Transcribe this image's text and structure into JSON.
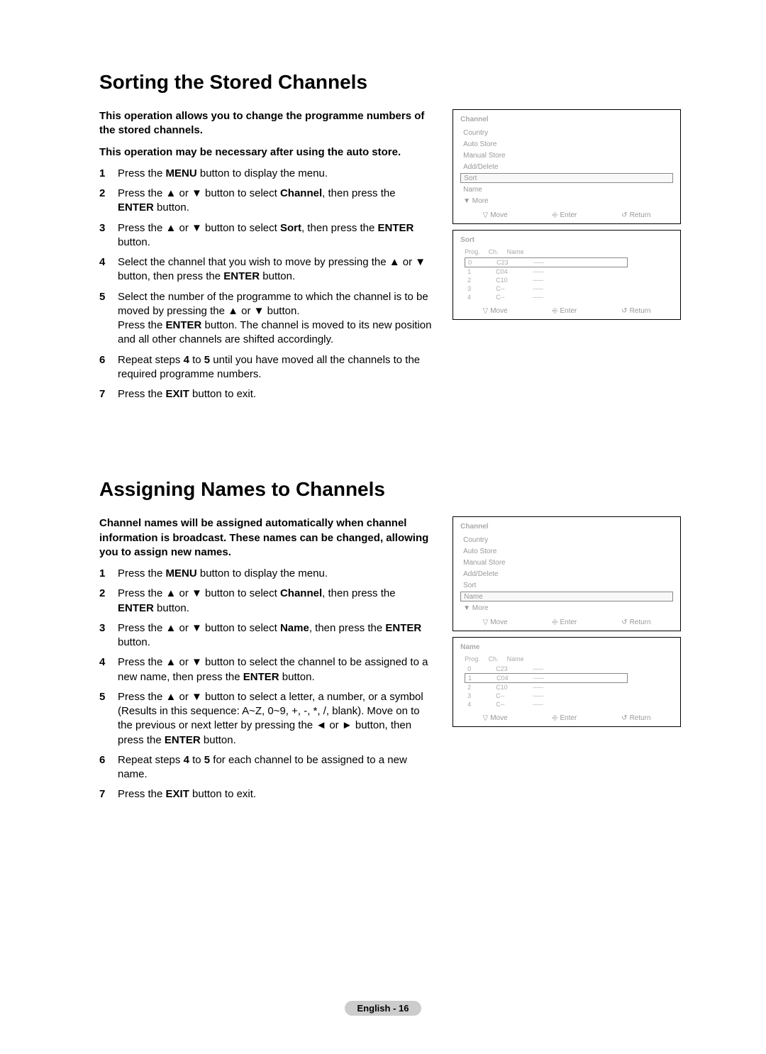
{
  "section1": {
    "heading": "Sorting the Stored Channels",
    "intro1": "This operation allows you to change the programme numbers of the stored channels.",
    "intro2": "This operation may be necessary after using the auto store.",
    "steps": [
      {
        "n": "1",
        "html": "Press the <b>MENU</b> button to display the menu."
      },
      {
        "n": "2",
        "html": "Press the ▲ or ▼ button to select <b>Channel</b>, then press the <b>ENTER</b> button."
      },
      {
        "n": "3",
        "html": "Press the ▲ or ▼ button to select <b>Sort</b>, then press the <b>ENTER</b> button."
      },
      {
        "n": "4",
        "html": "Select the channel that you wish to move by pressing the ▲ or ▼ button, then press the <b>ENTER</b> button."
      },
      {
        "n": "5",
        "html": "Select the number of the programme to which the channel is to be moved by pressing the ▲ or ▼ button.<br>Press the <b>ENTER</b> button. The channel is moved to its new position and all other channels are shifted accordingly."
      },
      {
        "n": "6",
        "html": "Repeat steps <b>4</b> to <b>5</b> until you have moved all the channels to the required programme numbers."
      },
      {
        "n": "7",
        "html": "Press the <b>EXIT</b> button to exit."
      }
    ],
    "osd1": {
      "title": "Channel",
      "rows": [
        "Country",
        "Auto Store",
        "Manual Store",
        "Add/Delete",
        "Sort",
        "Name"
      ],
      "more": "▼ More",
      "hlIndex": 4,
      "footer": {
        "move": "Move",
        "enter": "Enter",
        "return": "Return"
      }
    },
    "osd2": {
      "title": "Sort",
      "table": {
        "head": [
          "Prog.",
          "Ch.",
          "Name"
        ],
        "rows": [
          [
            "0",
            "C23",
            "-----"
          ],
          [
            "1",
            "C04",
            "-----"
          ],
          [
            "2",
            "C10",
            "-----"
          ],
          [
            "3",
            "C--",
            "-----"
          ],
          [
            "4",
            "C--",
            "-----"
          ]
        ],
        "hlIndex": 0
      },
      "footer": {
        "move": "Move",
        "enter": "Enter",
        "return": "Return"
      }
    }
  },
  "section2": {
    "heading": "Assigning Names to Channels",
    "intro1": "Channel names will be assigned automatically when channel information is broadcast. These names can be changed, allowing you to assign new names.",
    "steps": [
      {
        "n": "1",
        "html": "Press the <b>MENU</b> button to display the menu."
      },
      {
        "n": "2",
        "html": "Press the ▲ or ▼ button to select <b>Channel</b>, then press the <b>ENTER</b> button."
      },
      {
        "n": "3",
        "html": "Press the ▲ or ▼ button to select <b>Name</b>, then press the <b>ENTER</b> button."
      },
      {
        "n": "4",
        "html": "Press the ▲ or ▼ button to select the channel to be assigned to a new name, then press the <b>ENTER</b> button."
      },
      {
        "n": "5",
        "html": "Press the ▲ or ▼ button to select a letter, a number, or a symbol (Results in this sequence: A~Z, 0~9, +, -, *, /, blank). Move on to the previous or next letter by pressing the ◄ or ► button, then press the <b>ENTER</b> button."
      },
      {
        "n": "6",
        "html": "Repeat steps <b>4</b> to <b>5</b> for each channel to be assigned to a new name."
      },
      {
        "n": "7",
        "html": "Press the <b>EXIT</b> button to exit."
      }
    ],
    "osd1": {
      "title": "Channel",
      "rows": [
        "Country",
        "Auto Store",
        "Manual Store",
        "Add/Delete",
        "Sort",
        "Name"
      ],
      "more": "▼ More",
      "hlIndex": 5,
      "footer": {
        "move": "Move",
        "enter": "Enter",
        "return": "Return"
      }
    },
    "osd2": {
      "title": "Name",
      "table": {
        "head": [
          "Prog.",
          "Ch.",
          "Name"
        ],
        "rows": [
          [
            "0",
            "C23",
            "-----"
          ],
          [
            "1",
            "C04",
            "-----"
          ],
          [
            "2",
            "C10",
            "-----"
          ],
          [
            "3",
            "C--",
            "-----"
          ],
          [
            "4",
            "C--",
            "-----"
          ]
        ],
        "hlIndex": 1
      },
      "footer": {
        "move": "Move",
        "enter": "Enter",
        "return": "Return"
      }
    }
  },
  "footer": {
    "label": "English - 16"
  }
}
